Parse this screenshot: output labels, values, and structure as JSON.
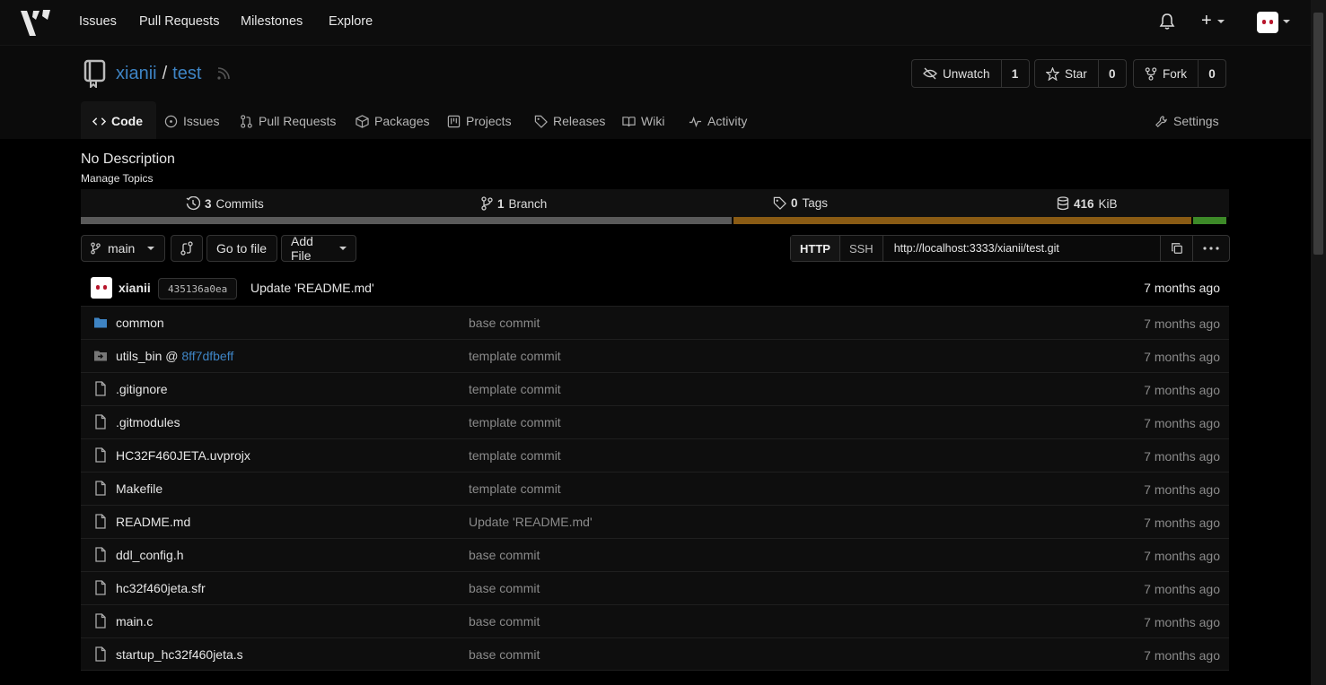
{
  "nav": {
    "items": [
      "Issues",
      "Pull Requests",
      "Milestones",
      "Explore"
    ],
    "plus": "+"
  },
  "repo": {
    "owner": "xianii",
    "name": "test",
    "separator": "/",
    "unwatch_label": "Unwatch",
    "watch_count": "1",
    "star_label": "Star",
    "star_count": "0",
    "fork_label": "Fork",
    "fork_count": "0"
  },
  "tabs": {
    "code": "Code",
    "issues": "Issues",
    "pulls": "Pull Requests",
    "packages": "Packages",
    "projects": "Projects",
    "releases": "Releases",
    "wiki": "Wiki",
    "activity": "Activity",
    "settings": "Settings"
  },
  "description": "No Description",
  "manage_topics": "Manage Topics",
  "stats": {
    "commits_num": "3",
    "commits_label": "Commits",
    "branch_num": "1",
    "branch_label": "Branch",
    "tags_num": "0",
    "tags_label": "Tags",
    "size_num": "416",
    "size_unit": "KiB"
  },
  "language_bar": [
    {
      "color": "#5a5a5a",
      "fraction": 0.569
    },
    {
      "color": "#8a5b14",
      "fraction": 0.4
    },
    {
      "color": "#3d8a28",
      "fraction": 0.029
    }
  ],
  "controls": {
    "branch": "main",
    "go_to_file": "Go to file",
    "add_file": "Add File"
  },
  "clone": {
    "http": "HTTP",
    "ssh": "SSH",
    "url": "http://localhost:3333/xianii/test.git"
  },
  "latest_commit": {
    "user": "xianii",
    "sha": "435136a0ea",
    "message": "Update 'README.md'",
    "time": "7 months ago"
  },
  "files": [
    {
      "name": "common",
      "type": "folder",
      "message": "base commit",
      "time": "7 months ago"
    },
    {
      "name": "utils_bin @ ",
      "submodule_ref": "8ff7dfbeff",
      "type": "submodule",
      "message": "template commit",
      "time": "7 months ago"
    },
    {
      "name": ".gitignore",
      "type": "file",
      "message": "template commit",
      "time": "7 months ago"
    },
    {
      "name": ".gitmodules",
      "type": "file",
      "message": "template commit",
      "time": "7 months ago"
    },
    {
      "name": "HC32F460JETA.uvprojx",
      "type": "file",
      "message": "template commit",
      "time": "7 months ago"
    },
    {
      "name": "Makefile",
      "type": "file",
      "message": "template commit",
      "time": "7 months ago"
    },
    {
      "name": "README.md",
      "type": "file",
      "message": "Update 'README.md'",
      "time": "7 months ago"
    },
    {
      "name": "ddl_config.h",
      "type": "file",
      "message": "base commit",
      "time": "7 months ago"
    },
    {
      "name": "hc32f460jeta.sfr",
      "type": "file",
      "message": "base commit",
      "time": "7 months ago"
    },
    {
      "name": "main.c",
      "type": "file",
      "message": "base commit",
      "time": "7 months ago"
    },
    {
      "name": "startup_hc32f460jeta.s",
      "type": "file",
      "message": "base commit",
      "time": "7 months ago"
    }
  ]
}
